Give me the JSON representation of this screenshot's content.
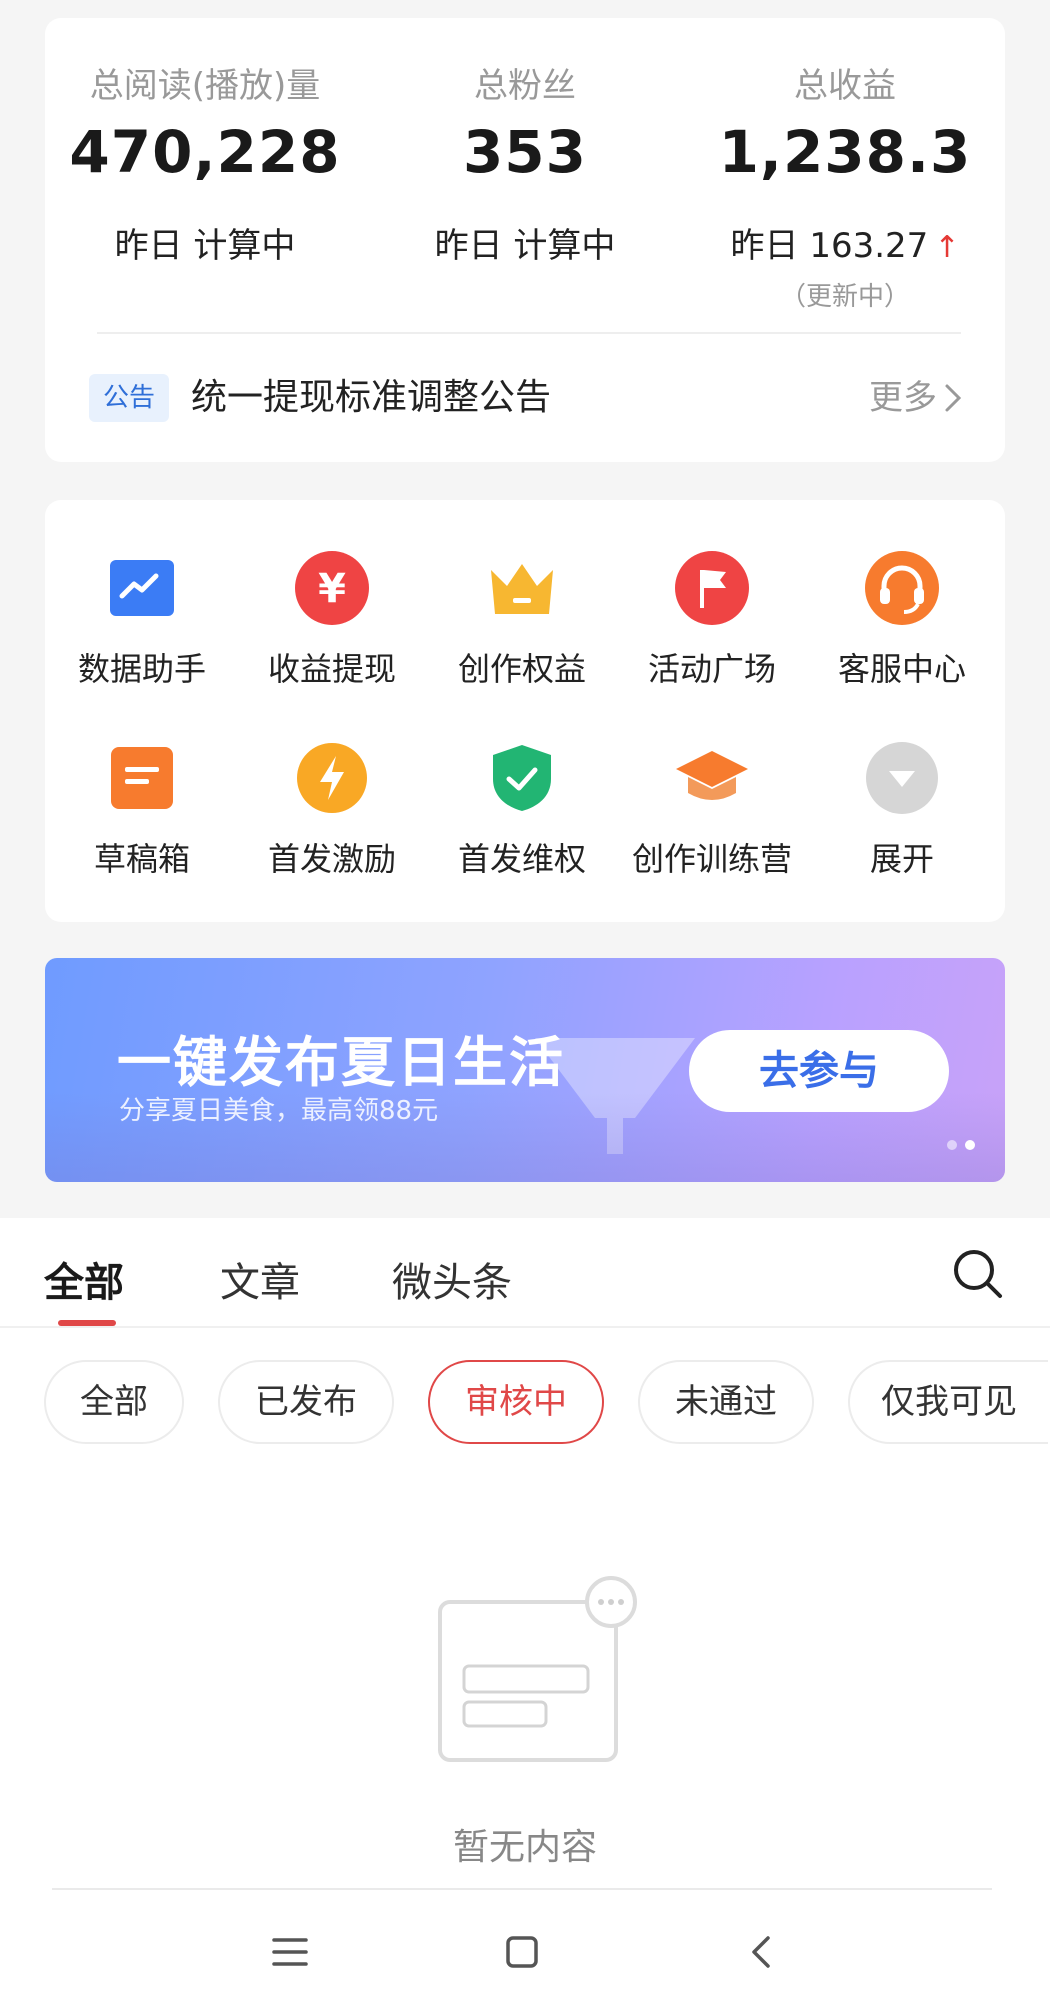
{
  "stats": {
    "reads": {
      "label": "总阅读(播放)量",
      "value": "470,228",
      "sub": "昨日 计算中"
    },
    "fans": {
      "label": "总粉丝",
      "value": "353",
      "sub": "昨日 计算中"
    },
    "income": {
      "label": "总收益",
      "value": "1,238.3",
      "sub": "昨日 163.27",
      "trend": "up",
      "note": "（更新中）"
    }
  },
  "notice": {
    "badge": "公告",
    "text": "统一提现标准调整公告",
    "more": "更多"
  },
  "tools": [
    {
      "label": "数据助手",
      "icon": "chart-icon",
      "color": "#3b7cf5"
    },
    {
      "label": "收益提现",
      "icon": "yuan-icon",
      "color": "#ef4444"
    },
    {
      "label": "创作权益",
      "icon": "crown-icon",
      "color": "#f7b731"
    },
    {
      "label": "活动广场",
      "icon": "flag-icon",
      "color": "#ef4444"
    },
    {
      "label": "客服中心",
      "icon": "headset-icon",
      "color": "#f77b2e"
    },
    {
      "label": "草稿箱",
      "icon": "draft-icon",
      "color": "#f77b2e"
    },
    {
      "label": "首发激励",
      "icon": "lightning-icon",
      "color": "#f9a825"
    },
    {
      "label": "首发维权",
      "icon": "shield-check-icon",
      "color": "#22b573"
    },
    {
      "label": "创作训练营",
      "icon": "graduation-cap-icon",
      "color": "#f77b2e"
    },
    {
      "label": "展开",
      "icon": "expand-icon",
      "color": "#cccccc"
    }
  ],
  "banner": {
    "title": "一键发布夏日生活",
    "subtitle": "分享夏日美食，最高领88元",
    "button": "去参与"
  },
  "tabs": [
    "全部",
    "文章",
    "微头条"
  ],
  "chips": [
    "全部",
    "已发布",
    "审核中",
    "未通过",
    "仅我可见"
  ],
  "active_chip": "审核中",
  "empty_text": "暂无内容",
  "colors": {
    "accent": "#e04848",
    "up_arrow": "#e53935",
    "notice_badge": "#2f6fd8"
  }
}
